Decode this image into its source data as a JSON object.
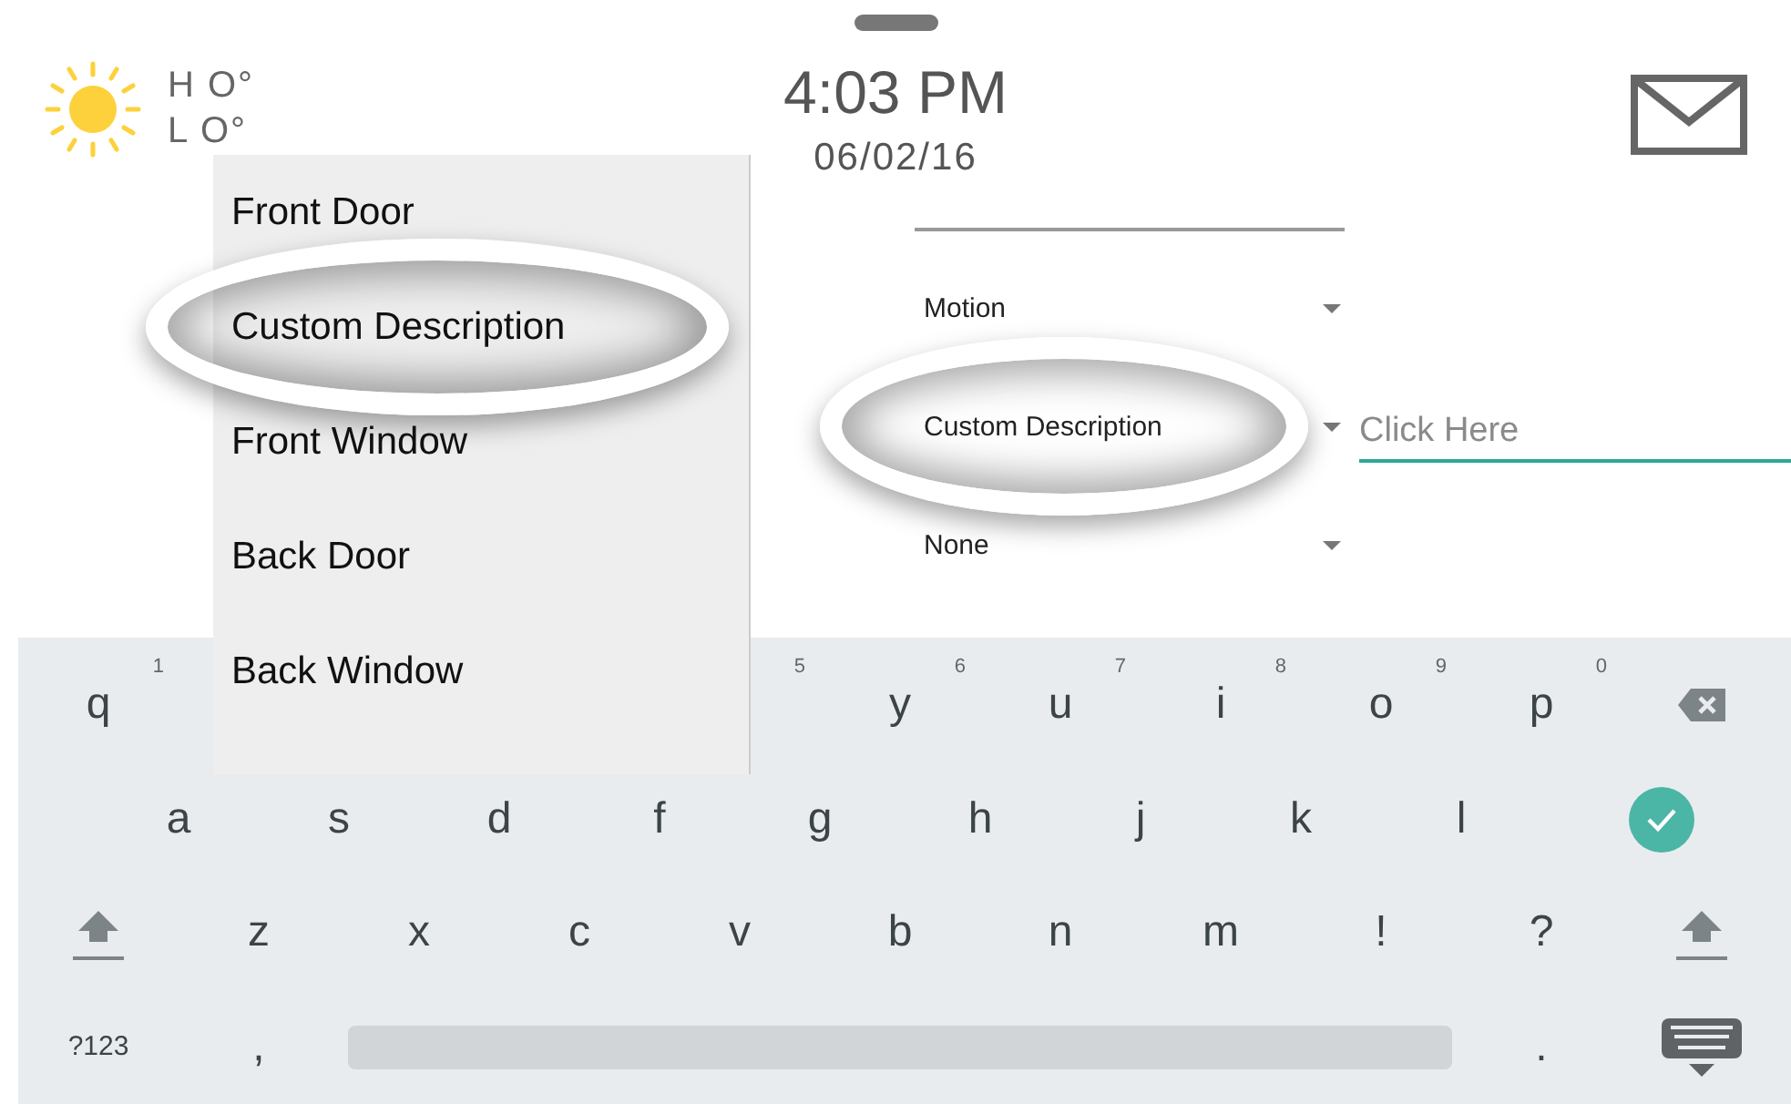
{
  "weather": {
    "high": "H O°",
    "low": "L O°"
  },
  "clock": {
    "time": "4:03 PM",
    "date": "06/02/16"
  },
  "form": {
    "dropdowns": [
      {
        "value": "Motion",
        "highlighted": false
      },
      {
        "value": "Custom Description",
        "highlighted": true
      },
      {
        "value": "None",
        "highlighted": false
      }
    ],
    "description_field": {
      "placeholder": "Click Here",
      "focused": true
    }
  },
  "menu": {
    "items": [
      {
        "label": "Front Door",
        "highlighted": false
      },
      {
        "label": "Custom Description",
        "highlighted": true
      },
      {
        "label": "Front Window",
        "highlighted": false
      },
      {
        "label": "Back Door",
        "highlighted": false
      },
      {
        "label": "Back Window",
        "highlighted": false
      }
    ]
  },
  "keyboard": {
    "rows": [
      [
        {
          "kind": "letter",
          "label": "q",
          "hint": "1"
        },
        {
          "kind": "covered"
        },
        {
          "kind": "covered"
        },
        {
          "kind": "covered"
        },
        {
          "kind": "covered",
          "hint": "5"
        },
        {
          "kind": "letter",
          "label": "y",
          "hint": "6"
        },
        {
          "kind": "letter",
          "label": "u",
          "hint": "7"
        },
        {
          "kind": "letter",
          "label": "i",
          "hint": "8"
        },
        {
          "kind": "letter",
          "label": "o",
          "hint": "9"
        },
        {
          "kind": "letter",
          "label": "p",
          "hint": "0"
        },
        {
          "kind": "backspace"
        }
      ],
      [
        {
          "kind": "letter",
          "label": "a"
        },
        {
          "kind": "letter",
          "label": "s"
        },
        {
          "kind": "letter",
          "label": "d"
        },
        {
          "kind": "letter",
          "label": "f"
        },
        {
          "kind": "letter",
          "label": "g"
        },
        {
          "kind": "letter",
          "label": "h"
        },
        {
          "kind": "letter",
          "label": "j"
        },
        {
          "kind": "letter",
          "label": "k"
        },
        {
          "kind": "letter",
          "label": "l"
        },
        {
          "kind": "enter"
        }
      ],
      [
        {
          "kind": "shift"
        },
        {
          "kind": "letter",
          "label": "z"
        },
        {
          "kind": "letter",
          "label": "x"
        },
        {
          "kind": "letter",
          "label": "c"
        },
        {
          "kind": "letter",
          "label": "v"
        },
        {
          "kind": "letter",
          "label": "b"
        },
        {
          "kind": "letter",
          "label": "n"
        },
        {
          "kind": "letter",
          "label": "m"
        },
        {
          "kind": "letter",
          "label": "!"
        },
        {
          "kind": "letter",
          "label": "?"
        },
        {
          "kind": "shift"
        }
      ]
    ],
    "bottom_row": {
      "left_keys": [
        {
          "kind": "symbols",
          "label": "?123"
        },
        {
          "kind": "letter",
          "label": ","
        }
      ],
      "right_keys": [
        {
          "kind": "letter",
          "label": "."
        },
        {
          "kind": "hide"
        }
      ]
    }
  }
}
